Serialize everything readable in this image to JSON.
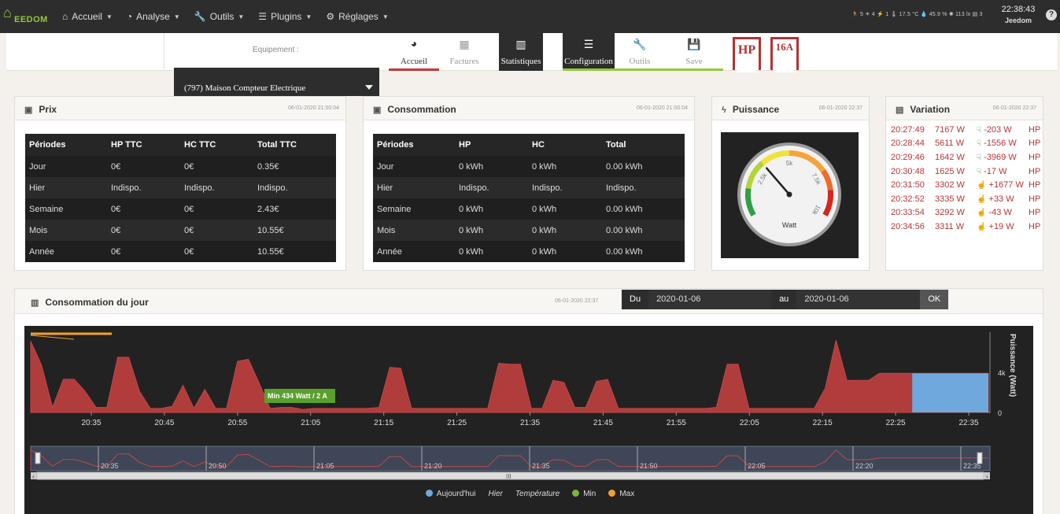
{
  "navbar": {
    "brand": "EEDOM",
    "menu": [
      {
        "label": "Accueil",
        "icon": "home-icon"
      },
      {
        "label": "Analyse",
        "icon": "dashboard-icon"
      },
      {
        "label": "Outils",
        "icon": "wrench-icon"
      },
      {
        "label": "Plugins",
        "icon": "list-icon"
      },
      {
        "label": "Réglages",
        "icon": "gear-icon"
      }
    ],
    "status": "🏃 5 ☀ 4 ⚡ 1  🌡 17.5 °C  💧 45.9 %  ✺ 113 lx  ▤ 3",
    "time": "22:38:43",
    "user": "Jeedom"
  },
  "topbar": {
    "equipment_label": "Equipement :",
    "equipment_value": "(797) Maison Compteur Electrique",
    "tabs": [
      {
        "label": "Accueil",
        "icon": "◕"
      },
      {
        "label": "Factures",
        "icon": "▦"
      },
      {
        "label": "Statistiques",
        "icon": "▥"
      },
      {
        "label": "Configuration",
        "icon": "☰"
      },
      {
        "label": "Outils",
        "icon": "🔧"
      },
      {
        "label": "Save",
        "icon": "💾"
      }
    ],
    "ribbon_hp": "HP",
    "ribbon_16a": "16A"
  },
  "prix": {
    "title": "Prix",
    "date": "06-01-2020 21:00:04",
    "headers": [
      "Périodes",
      "HP TTC",
      "HC TTC",
      "Total TTC"
    ],
    "rows": [
      [
        "Jour",
        "0€",
        "0€",
        "0.35€"
      ],
      [
        "Hier",
        "Indispo.",
        "Indispo.",
        "Indispo."
      ],
      [
        "Semaine",
        "0€",
        "0€",
        "2.43€"
      ],
      [
        "Mois",
        "0€",
        "0€",
        "10.55€"
      ],
      [
        "Année",
        "0€",
        "0€",
        "10.55€"
      ]
    ]
  },
  "consommation": {
    "title": "Consommation",
    "date": "06-01-2020 21:00:04",
    "headers": [
      "Périodes",
      "HP",
      "HC",
      "Total"
    ],
    "rows": [
      [
        "Jour",
        "0 kWh",
        "0 kWh",
        "0.00 kWh"
      ],
      [
        "Hier",
        "Indispo.",
        "Indispo.",
        "Indispo."
      ],
      [
        "Semaine",
        "0 kWh",
        "0 kWh",
        "0.00 kWh"
      ],
      [
        "Mois",
        "0 kWh",
        "0 kWh",
        "0.00 kWh"
      ],
      [
        "Année",
        "0 kWh",
        "0 kWh",
        "0.00 kWh"
      ]
    ]
  },
  "puissance": {
    "title": "Puissance",
    "date": "06-01-2020 22:37",
    "gauge": {
      "unit": "Watt",
      "value": 3300,
      "min": 0,
      "max": 10000,
      "ticks": [
        "2.5k",
        "5k",
        "7.5k",
        "10k"
      ]
    }
  },
  "variation": {
    "title": "Variation",
    "date": "06-01-2020 22:37",
    "rows": [
      {
        "time": "20:27:49",
        "value": "7167 W",
        "delta": "-203 W",
        "dir": "down",
        "tarif": "HP"
      },
      {
        "time": "20:28:44",
        "value": "5611 W",
        "delta": "-1556 W",
        "dir": "down",
        "tarif": "HP"
      },
      {
        "time": "20:29:46",
        "value": "1642 W",
        "delta": "-3969 W",
        "dir": "down",
        "tarif": "HP"
      },
      {
        "time": "20:30:48",
        "value": "1625 W",
        "delta": "-17 W",
        "dir": "down",
        "tarif": "HP"
      },
      {
        "time": "20:31:50",
        "value": "3302 W",
        "delta": "+1677 W",
        "dir": "up",
        "tarif": "HP"
      },
      {
        "time": "20:32:52",
        "value": "3335 W",
        "delta": "+33 W",
        "dir": "up",
        "tarif": "HP"
      },
      {
        "time": "20:33:54",
        "value": "3292 W",
        "delta": "-43 W",
        "dir": "down",
        "tarif": "HP"
      },
      {
        "time": "20:34:56",
        "value": "3311 W",
        "delta": "+19 W",
        "dir": "up",
        "tarif": "HP"
      }
    ]
  },
  "daily": {
    "title": "Consommation du jour",
    "date": "06-01-2020 22:37",
    "from_label": "Du",
    "from_value": "2020-01-06",
    "to_label": "au",
    "to_value": "2020-01-06",
    "ok_label": "OK"
  },
  "chart_data": {
    "type": "area",
    "x": [
      "20:30",
      "20:32",
      "20:34",
      "20:36",
      "20:38",
      "20:40",
      "20:42",
      "20:44",
      "20:46",
      "20:48",
      "20:50",
      "20:52",
      "20:54",
      "20:56",
      "20:58",
      "21:00",
      "21:02",
      "21:04",
      "21:06",
      "21:08",
      "21:10",
      "21:12",
      "21:14",
      "21:16",
      "21:18",
      "21:20",
      "21:22",
      "21:24",
      "21:26",
      "21:28",
      "21:30",
      "21:32",
      "21:34",
      "21:36",
      "21:38",
      "21:40",
      "21:42",
      "21:44",
      "21:46",
      "21:48",
      "21:50",
      "21:52",
      "21:54",
      "21:56",
      "21:58",
      "22:00",
      "22:02",
      "22:04",
      "22:06",
      "22:08",
      "22:10",
      "22:12",
      "22:14",
      "22:16",
      "22:18",
      "22:20",
      "22:22",
      "22:24",
      "22:26",
      "22:28",
      "22:30",
      "22:32",
      "22:34",
      "22:36"
    ],
    "series": [
      {
        "name": "Aujourd'hui",
        "color": "#b03c3c",
        "values": [
          7100,
          4700,
          500,
          3300,
          3300,
          2100,
          500,
          500,
          5500,
          5500,
          2100,
          400,
          400,
          600,
          2700,
          400,
          2300,
          400,
          400,
          5100,
          5300,
          2900,
          400,
          500,
          500,
          300,
          400,
          400,
          400,
          400,
          400,
          400,
          500,
          4500,
          4400,
          400,
          400,
          400,
          400,
          400,
          400,
          400,
          400,
          4900,
          4800,
          4800,
          400,
          400,
          3200,
          3000,
          500,
          500,
          3100,
          3300,
          400,
          400,
          400,
          400,
          400,
          400,
          400,
          400,
          400,
          500,
          4800,
          4800,
          400,
          400,
          400,
          400,
          400,
          400,
          400,
          2400,
          7200,
          3200,
          3200,
          3200,
          3900,
          3900,
          3900,
          3900,
          3900,
          3900,
          3900,
          3900,
          3900,
          3900,
          3900
        ]
      }
    ],
    "x_ticks": [
      "20:35",
      "20:45",
      "20:55",
      "21:05",
      "21:15",
      "21:25",
      "21:35",
      "21:45",
      "21:55",
      "22:05",
      "22:15",
      "22:25",
      "22:35"
    ],
    "navigator_ticks": [
      "20:35",
      "20:50",
      "21:05",
      "21:20",
      "21:35",
      "21:50",
      "22:05",
      "22:20",
      "22:35"
    ],
    "y_ticks": [
      "0",
      "4k"
    ],
    "ylabel": "Puissance (Watt)",
    "ylim": [
      0,
      8000
    ],
    "tooltip": "Min 434 Watt / 2 A",
    "legend": [
      {
        "name": "Aujourd'hui",
        "color": "#6fa8dc"
      },
      {
        "name": "Hier",
        "color": ""
      },
      {
        "name": "Température",
        "color": ""
      },
      {
        "name": "Min",
        "color": "#7cb342"
      },
      {
        "name": "Max",
        "color": "#f0a030"
      }
    ]
  }
}
